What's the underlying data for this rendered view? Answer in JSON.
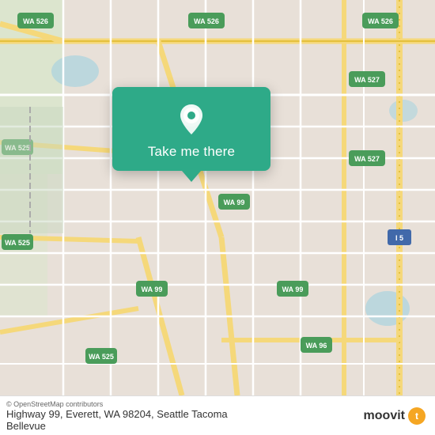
{
  "map": {
    "background_color": "#e8e0d8",
    "road_color": "#ffffff",
    "highway_color": "#f5d87a",
    "highway_stroke": "#d4a800",
    "water_color": "#aad3df",
    "green_color": "#c8dfc4"
  },
  "popup": {
    "background": "#2eaa88",
    "button_label": "Take me there"
  },
  "road_labels": [
    {
      "id": "wa526_top_left",
      "text": "WA 526"
    },
    {
      "id": "wa526_top_mid",
      "text": "WA 526"
    },
    {
      "id": "wa526_top_right",
      "text": "WA 526"
    },
    {
      "id": "wa527_right1",
      "text": "WA 527"
    },
    {
      "id": "wa527_right2",
      "text": "WA 527"
    },
    {
      "id": "wa99_mid",
      "text": "WA 99"
    },
    {
      "id": "wa99_lower_left",
      "text": "WA 99"
    },
    {
      "id": "wa99_lower_right",
      "text": "WA 99"
    },
    {
      "id": "wa525_left1",
      "text": "WA 525"
    },
    {
      "id": "wa525_left2",
      "text": "WA 525"
    },
    {
      "id": "wa525_bottom",
      "text": "WA 525"
    },
    {
      "id": "i5_right",
      "text": "I 5"
    },
    {
      "id": "wa96_bottom",
      "text": "WA 96"
    }
  ],
  "footer": {
    "copyright": "© OpenStreetMap contributors",
    "address": "Highway 99, Everett, WA 98204, Seattle Tacoma",
    "address_line2": "Bellevue",
    "logo_text": "moovit"
  },
  "icons": {
    "pin": "location-pin-icon",
    "moovit": "moovit-logo-icon"
  }
}
